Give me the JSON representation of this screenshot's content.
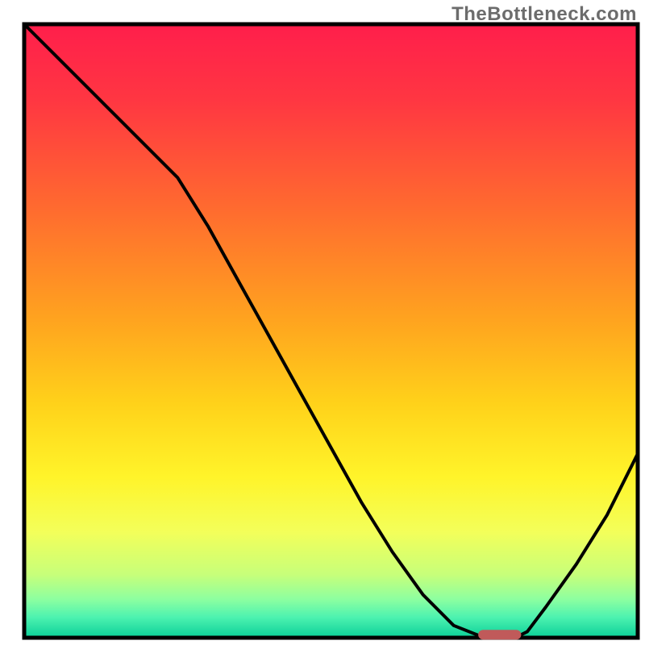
{
  "watermark": "TheBottleneck.com",
  "chart_data": {
    "type": "line",
    "title": "",
    "xlabel": "",
    "ylabel": "",
    "xlim": [
      0,
      100
    ],
    "ylim": [
      0,
      100
    ],
    "grid": false,
    "legend": false,
    "series": [
      {
        "name": "curve",
        "x": [
          0,
          5,
          10,
          15,
          20,
          25,
          30,
          35,
          40,
          45,
          50,
          55,
          60,
          65,
          70,
          75,
          80,
          82,
          85,
          90,
          95,
          100
        ],
        "y": [
          100,
          95,
          90,
          85,
          80,
          75,
          67,
          58,
          49,
          40,
          31,
          22,
          14,
          7,
          2,
          0,
          0,
          1,
          5,
          12,
          20,
          30
        ]
      },
      {
        "name": "optimal-marker",
        "x": [
          74,
          81
        ],
        "y": [
          0.5,
          0.5
        ]
      }
    ],
    "gradient_stops": [
      {
        "offset": 0,
        "color": "#ff1f4b"
      },
      {
        "offset": 0.12,
        "color": "#ff3642"
      },
      {
        "offset": 0.3,
        "color": "#ff6b2f"
      },
      {
        "offset": 0.48,
        "color": "#ffa31f"
      },
      {
        "offset": 0.62,
        "color": "#ffd21a"
      },
      {
        "offset": 0.74,
        "color": "#fff42a"
      },
      {
        "offset": 0.83,
        "color": "#f3ff5a"
      },
      {
        "offset": 0.9,
        "color": "#c7ff7a"
      },
      {
        "offset": 0.94,
        "color": "#8dffa0"
      },
      {
        "offset": 0.97,
        "color": "#4cf2b0"
      },
      {
        "offset": 1.0,
        "color": "#11d39a"
      }
    ],
    "frame_color": "#000000",
    "curve_color": "#000000",
    "marker_color": "#c05a5a"
  },
  "plot": {
    "outer_left": 30,
    "outer_top": 30,
    "outer_right": 791,
    "outer_bottom": 791,
    "stroke_width_frame": 5,
    "stroke_width_curve": 4,
    "marker_thickness": 12,
    "marker_radius": 6
  }
}
